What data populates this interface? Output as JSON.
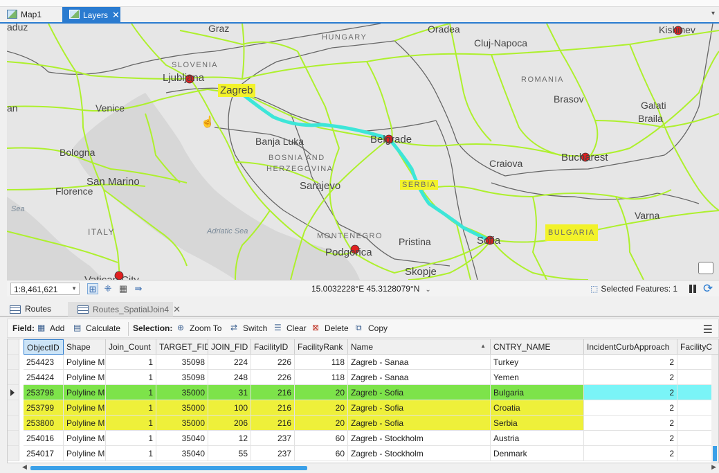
{
  "tabs": {
    "map1": "Map1",
    "layers": "Layers"
  },
  "map": {
    "labels": {
      "graz": "Graz",
      "hungary": "HUNGARY",
      "oradea": "Oradea",
      "cluj": "Cluj-Napoca",
      "kishinev": "Kishinev",
      "slovenia": "SLOVENIA",
      "ljubljana": "Ljubljana",
      "zagreb": "Zagreb",
      "romania": "ROMANIA",
      "brasov": "Brasov",
      "venice": "Venice",
      "galati": "Galati",
      "braila": "Braila",
      "banja_luka": "Banja Luka",
      "belgrade": "Belgrade",
      "bosnia": "BOSNIA AND",
      "herzegovina": "HERZEGOVINA",
      "bologna": "Bologna",
      "craiova": "Craiova",
      "bucharest": "Bucharest",
      "san_marino": "San Marino",
      "sarajevo": "Sarajevo",
      "serbia": "SERBIA",
      "florence": "Florence",
      "sea": "Sea",
      "italy": "ITALY",
      "adriatic": "Adriatic Sea",
      "varna": "Varna",
      "montenegro": "MONTENEGRO",
      "pristina": "Pristina",
      "sofia": "Sofia",
      "bulgaria": "BULGARIA",
      "podgorica": "Podgorica",
      "skopje": "Skopje",
      "vatican": "Vatican City",
      "an": "an",
      "aduz": "aduz"
    },
    "colors": {
      "roads": "#aef02d",
      "route": "#3de6d8",
      "highlight": "#f2f22a",
      "stop": "#e02020"
    }
  },
  "status": {
    "scale": "1:8,461,621",
    "coordinates": "15.0032228°E 45.3128079°N",
    "selected_features": "Selected Features: 1"
  },
  "table_tabs": {
    "routes": "Routes",
    "spatial_join": "Routes_SpatialJoin4"
  },
  "toolbar": {
    "field_label": "Field:",
    "add": "Add",
    "calculate": "Calculate",
    "selection_label": "Selection:",
    "zoom_to": "Zoom To",
    "switch": "Switch",
    "clear": "Clear",
    "delete": "Delete",
    "copy": "Copy"
  },
  "grid": {
    "columns": [
      "ObjectID",
      "Shape",
      "Join_Count",
      "TARGET_FID",
      "JOIN_FID",
      "FacilityID",
      "FacilityRank",
      "Name",
      "CNTRY_NAME",
      "IncidentCurbApproach",
      "FacilityC"
    ],
    "rows": [
      [
        "254423",
        "Polyline M",
        "1",
        "35098",
        "224",
        "226",
        "118",
        "Zagreb - Sanaa",
        "Turkey",
        "2",
        ""
      ],
      [
        "254424",
        "Polyline M",
        "1",
        "35098",
        "248",
        "226",
        "118",
        "Zagreb - Sanaa",
        "Yemen",
        "2",
        ""
      ],
      [
        "253798",
        "Polyline M",
        "1",
        "35000",
        "31",
        "216",
        "20",
        "Zagreb - Sofia",
        "Bulgaria",
        "2",
        ""
      ],
      [
        "253799",
        "Polyline M",
        "1",
        "35000",
        "100",
        "216",
        "20",
        "Zagreb - Sofia",
        "Croatia",
        "2",
        ""
      ],
      [
        "253800",
        "Polyline M",
        "1",
        "35000",
        "206",
        "216",
        "20",
        "Zagreb - Sofia",
        "Serbia",
        "2",
        ""
      ],
      [
        "254016",
        "Polyline M",
        "1",
        "35040",
        "12",
        "237",
        "60",
        "Zagreb - Stockholm",
        "Austria",
        "2",
        ""
      ],
      [
        "254017",
        "Polyline M",
        "1",
        "35040",
        "55",
        "237",
        "60",
        "Zagreb - Stockholm",
        "Denmark",
        "2",
        ""
      ]
    ]
  }
}
